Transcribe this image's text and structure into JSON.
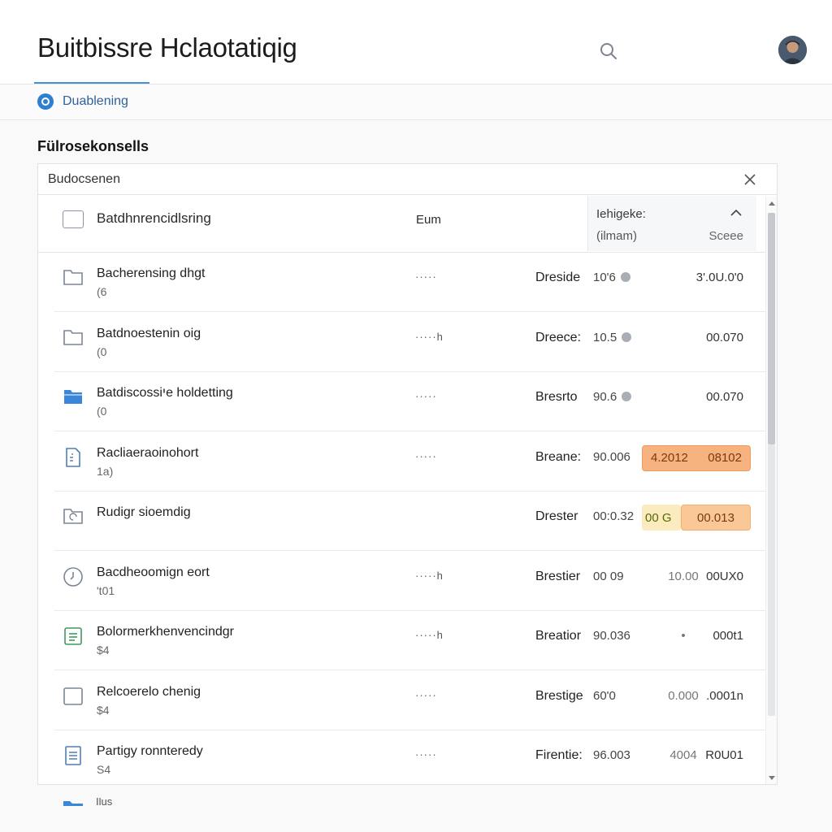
{
  "header": {
    "title": "Buitbissre Hclaotatiqig"
  },
  "tabs": {
    "status_label": "Duablening"
  },
  "section": {
    "title": "Fülrosekonsells"
  },
  "search": {
    "value": "Budocsenen"
  },
  "table": {
    "col_name": "Batdhnrencidlsring",
    "col_eum": "Eum",
    "col_sort_name": "Iehigeke:",
    "col_sort_sub": "(ilmam)",
    "col_score": "Sceee"
  },
  "rows": [
    {
      "icon": "folder-outline-icon",
      "name": "Bacherensing dhgt",
      "sub": "(6",
      "dots": "·····",
      "type": "Dreside",
      "v1": "10'6",
      "info": true,
      "v2": "",
      "v3": "3'.0U.0'0",
      "highlight": ""
    },
    {
      "icon": "folder-outline-icon",
      "name": "Batdnoestenin oig",
      "sub": "(0",
      "dots": "·····h",
      "type": "Dreece:",
      "v1": "10.5",
      "info": true,
      "v2": "",
      "v3": "00.070",
      "highlight": ""
    },
    {
      "icon": "folder-filled-icon",
      "name": "Batdiscossiיe holdetting",
      "sub": "(0",
      "dots": "·····",
      "type": "Bresrto",
      "v1": "90.6",
      "info": true,
      "v2": "",
      "v3": "00.070",
      "highlight": ""
    },
    {
      "icon": "document-icon",
      "name": "Racliaeraoinohort",
      "sub": "1a)",
      "dots": "·····",
      "type": "Breane:",
      "v1": "90.006",
      "info": false,
      "v2": "4.2012",
      "v3": "08102",
      "highlight": "a"
    },
    {
      "icon": "folder-sync-icon",
      "name": "Rudigr sioemdig",
      "sub": "",
      "dots": "",
      "type": "Drester",
      "v1": "00:0.32",
      "info": false,
      "v2": "00 G",
      "v3": "00.013",
      "highlight": "b"
    },
    {
      "icon": "clock-icon",
      "name": "Bacdheoomign eort",
      "sub": "'t01",
      "dots": "·····h",
      "type": "Brestier",
      "v1": "00 09",
      "info": false,
      "v2": "10.00",
      "v3": "00UX0",
      "highlight": ""
    },
    {
      "icon": "list-icon",
      "name": "Bolormerkhenvencindgr",
      "sub": "$4",
      "dots": "·····h",
      "type": "Breatior",
      "v1": "90.036",
      "info": false,
      "v2": "•",
      "v3": "000t1",
      "highlight": ""
    },
    {
      "icon": "checkbox-icon",
      "name": "Relcoerelo chenig",
      "sub": "$4",
      "dots": "·····",
      "type": "Brestige",
      "v1": "60'0",
      "info": false,
      "v2": "0.000",
      "v3": ".0001n",
      "highlight": ""
    },
    {
      "icon": "document-lines-icon",
      "name": "Partigy ronnteredy",
      "sub": "S4",
      "dots": "·····",
      "type": "Firentie:",
      "v1": "96.003",
      "info": false,
      "v2": "4004",
      "v3": "R0U01",
      "highlight": ""
    }
  ],
  "peek": {
    "label": "Ilus"
  },
  "colors": {
    "accent": "#2f7fd0",
    "highlight_orange": "#f6b27f",
    "highlight_yellow": "#fdebc0"
  }
}
